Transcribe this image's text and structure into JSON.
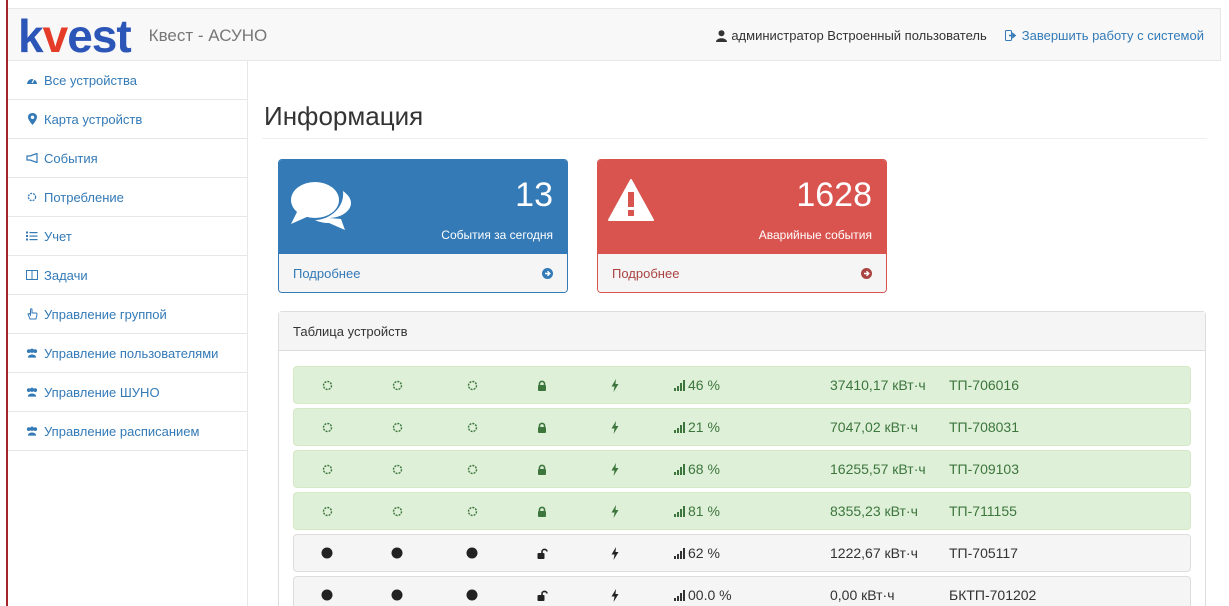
{
  "app": {
    "logo_prefix": "k",
    "logo_mark": "v",
    "logo_suffix": "est",
    "title": "Квест - АСУНО"
  },
  "navbar": {
    "user": "администратор Встроенный пользователь",
    "logout": "Завершить работу с системой"
  },
  "sidebar": {
    "items": [
      {
        "label": "Все устройства",
        "icon": "dashboard-icon"
      },
      {
        "label": "Карта устройств",
        "icon": "map-marker-icon"
      },
      {
        "label": "События",
        "icon": "bullhorn-icon"
      },
      {
        "label": "Потребление",
        "icon": "sun-icon"
      },
      {
        "label": "Учет",
        "icon": "list-icon"
      },
      {
        "label": "Задачи",
        "icon": "columns-icon"
      },
      {
        "label": "Управление группой",
        "icon": "hand-pointer-icon"
      },
      {
        "label": "Управление пользователями",
        "icon": "users-icon"
      },
      {
        "label": "Управление ШУНО",
        "icon": "users-icon"
      },
      {
        "label": "Управление расписанием",
        "icon": "users-icon"
      }
    ]
  },
  "main": {
    "title": "Информация",
    "cards": {
      "events": {
        "count": "13",
        "label": "События за сегодня",
        "more": "Подробнее",
        "icon": "comments-icon",
        "color": "#337ab7"
      },
      "alarms": {
        "count": "1628",
        "label": "Аварийные события",
        "more": "Подробнее",
        "icon": "warning-icon",
        "color": "#d9534f"
      }
    },
    "devices": {
      "title": "Таблица устройств",
      "rows": [
        {
          "state": "on",
          "signal": "46 %",
          "energy": "37410,17 кВт·ч",
          "name": "ТП-706016"
        },
        {
          "state": "on",
          "signal": "21 %",
          "energy": "7047,02 кВт·ч",
          "name": "ТП-708031"
        },
        {
          "state": "on",
          "signal": "68 %",
          "energy": "16255,57 кВт·ч",
          "name": "ТП-709103"
        },
        {
          "state": "on",
          "signal": "81 %",
          "energy": "8355,23 кВт·ч",
          "name": "ТП-711155"
        },
        {
          "state": "off",
          "signal": "62 %",
          "energy": "1222,67 кВт·ч",
          "name": "ТП-705117"
        },
        {
          "state": "off",
          "signal": "00.0 %",
          "energy": "0,00 кВт·ч",
          "name": "БКТП-701202"
        }
      ]
    }
  },
  "colors": {
    "brand_blue": "#2c55b8",
    "brand_red": "#e53c2a",
    "link": "#337ab7",
    "success_bg": "#dff0d8",
    "success_text": "#3c763d"
  }
}
